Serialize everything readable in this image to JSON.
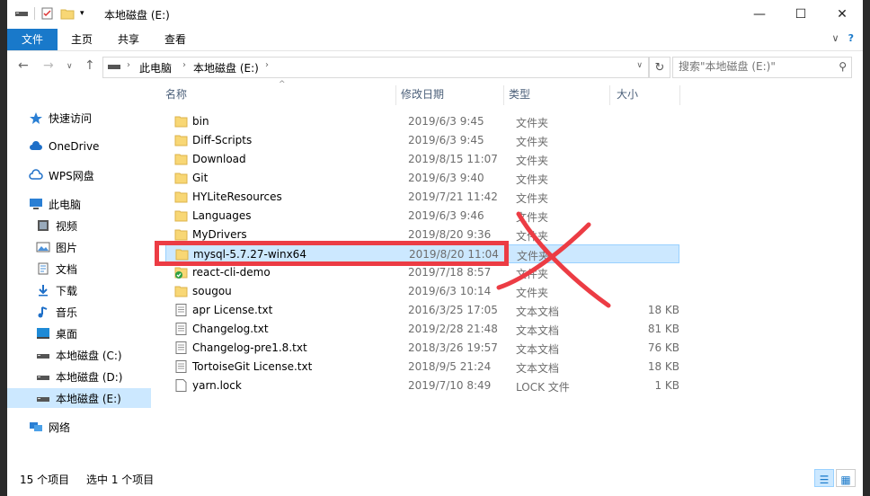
{
  "window": {
    "title": "本地磁盘 (E:)",
    "caption": {
      "minimize": "—",
      "maximize": "☐",
      "close": "✕"
    }
  },
  "ribbon": {
    "tabs": [
      "文件",
      "主页",
      "共享",
      "查看"
    ],
    "expand": "∨",
    "help": "?"
  },
  "nav": {
    "back": "←",
    "forward": "→",
    "recent": "∨",
    "up": "↑",
    "breadcrumb": [
      "此电脑",
      "本地磁盘 (E:)"
    ],
    "search_placeholder": "搜索\"本地磁盘 (E:)\""
  },
  "sidebar": {
    "items": [
      {
        "label": "快速访问",
        "icon": "star-icon"
      },
      {
        "label": "OneDrive",
        "icon": "cloud-icon"
      },
      {
        "label": "WPS网盘",
        "icon": "wps-cloud-icon"
      },
      {
        "label": "此电脑",
        "icon": "computer-icon"
      },
      {
        "label": "视频",
        "icon": "video-icon"
      },
      {
        "label": "图片",
        "icon": "picture-icon"
      },
      {
        "label": "文档",
        "icon": "document-icon"
      },
      {
        "label": "下载",
        "icon": "download-icon"
      },
      {
        "label": "音乐",
        "icon": "music-icon"
      },
      {
        "label": "桌面",
        "icon": "desktop-icon"
      },
      {
        "label": "本地磁盘 (C:)",
        "icon": "drive-icon"
      },
      {
        "label": "本地磁盘 (D:)",
        "icon": "drive-icon"
      },
      {
        "label": "本地磁盘 (E:)",
        "icon": "drive-icon",
        "selected": true
      },
      {
        "label": "网络",
        "icon": "network-icon"
      }
    ]
  },
  "columns": [
    "名称",
    "修改日期",
    "类型",
    "大小"
  ],
  "files": [
    {
      "name": "bin",
      "date": "2019/6/3 9:45",
      "type": "文件夹",
      "size": "",
      "icon": "folder-icon"
    },
    {
      "name": "Diff-Scripts",
      "date": "2019/6/3 9:45",
      "type": "文件夹",
      "size": "",
      "icon": "folder-icon"
    },
    {
      "name": "Download",
      "date": "2019/8/15 11:07",
      "type": "文件夹",
      "size": "",
      "icon": "folder-icon"
    },
    {
      "name": "Git",
      "date": "2019/6/3 9:40",
      "type": "文件夹",
      "size": "",
      "icon": "folder-icon"
    },
    {
      "name": "HYLiteResources",
      "date": "2019/7/21 11:42",
      "type": "文件夹",
      "size": "",
      "icon": "folder-icon"
    },
    {
      "name": "Languages",
      "date": "2019/6/3 9:46",
      "type": "文件夹",
      "size": "",
      "icon": "folder-icon"
    },
    {
      "name": "MyDrivers",
      "date": "2019/8/20 9:36",
      "type": "文件夹",
      "size": "",
      "icon": "folder-icon"
    },
    {
      "name": "mysql-5.7.27-winx64",
      "date": "2019/8/20 11:04",
      "type": "文件夹",
      "size": "",
      "icon": "folder-icon",
      "selected": true
    },
    {
      "name": "react-cli-demo",
      "date": "2019/7/18 8:57",
      "type": "文件夹",
      "size": "",
      "icon": "folder-synced-icon"
    },
    {
      "name": "sougou",
      "date": "2019/6/3 10:14",
      "type": "文件夹",
      "size": "",
      "icon": "folder-icon"
    },
    {
      "name": "apr License.txt",
      "date": "2016/3/25 17:05",
      "type": "文本文档",
      "size": "18 KB",
      "icon": "text-file-icon"
    },
    {
      "name": "Changelog.txt",
      "date": "2019/2/28 21:48",
      "type": "文本文档",
      "size": "81 KB",
      "icon": "text-file-icon"
    },
    {
      "name": "Changelog-pre1.8.txt",
      "date": "2018/3/26 19:57",
      "type": "文本文档",
      "size": "76 KB",
      "icon": "text-file-icon"
    },
    {
      "name": "TortoiseGit License.txt",
      "date": "2018/9/5 21:24",
      "type": "文本文档",
      "size": "18 KB",
      "icon": "text-file-icon"
    },
    {
      "name": "yarn.lock",
      "date": "2019/7/10 8:49",
      "type": "LOCK 文件",
      "size": "1 KB",
      "icon": "blank-file-icon"
    }
  ],
  "status": {
    "count": "15 个项目",
    "selection": "选中 1 个项目"
  },
  "colors": {
    "accent": "#1979ca",
    "selection": "#cce8ff",
    "annotation": "#ec3c44",
    "folder": "#f8d775"
  }
}
